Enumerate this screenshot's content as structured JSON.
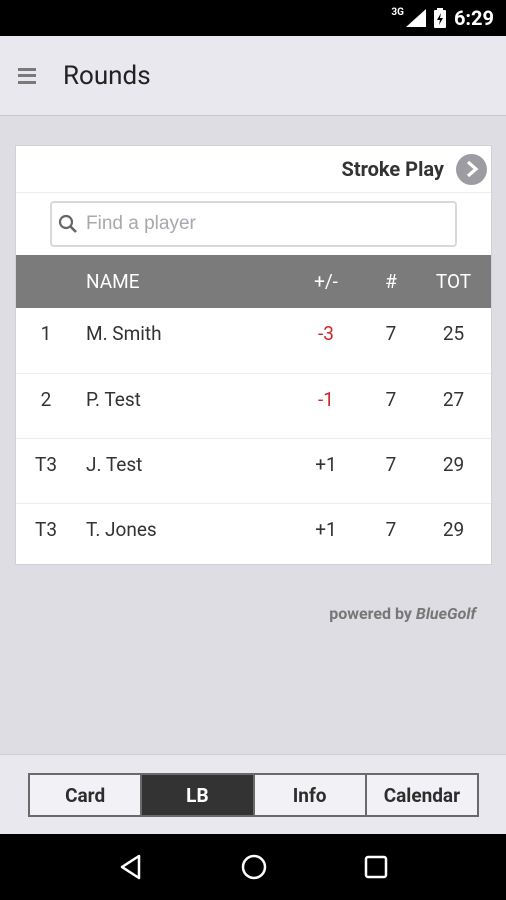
{
  "status_bar": {
    "network": "3G",
    "time": "6:29"
  },
  "app_bar": {
    "title": "Rounds"
  },
  "card": {
    "mode": "Stroke Play",
    "search": {
      "placeholder": "Find a player",
      "value": ""
    },
    "columns": {
      "rank": "",
      "name": "NAME",
      "plus_minus": "+/-",
      "holes": "#",
      "total": "TOT"
    },
    "rows": [
      {
        "rank": "1",
        "name": "M. Smith",
        "plus_minus": "-3",
        "holes": "7",
        "total": "25"
      },
      {
        "rank": "2",
        "name": "P. Test",
        "plus_minus": "-1",
        "holes": "7",
        "total": "27"
      },
      {
        "rank": "T3",
        "name": "J. Test",
        "plus_minus": "+1",
        "holes": "7",
        "total": "29"
      },
      {
        "rank": "T3",
        "name": "T. Jones",
        "plus_minus": "+1",
        "holes": "7",
        "total": "29"
      }
    ]
  },
  "footer": {
    "powered_by": "powered by",
    "brand": "BlueGolf"
  },
  "tabs": [
    "Card",
    "LB",
    "Info",
    "Calendar"
  ],
  "active_tab": "LB",
  "colors": {
    "negative": "#cc2a2a",
    "header_bg": "#7b7b7b",
    "active_tab": "#333333"
  }
}
